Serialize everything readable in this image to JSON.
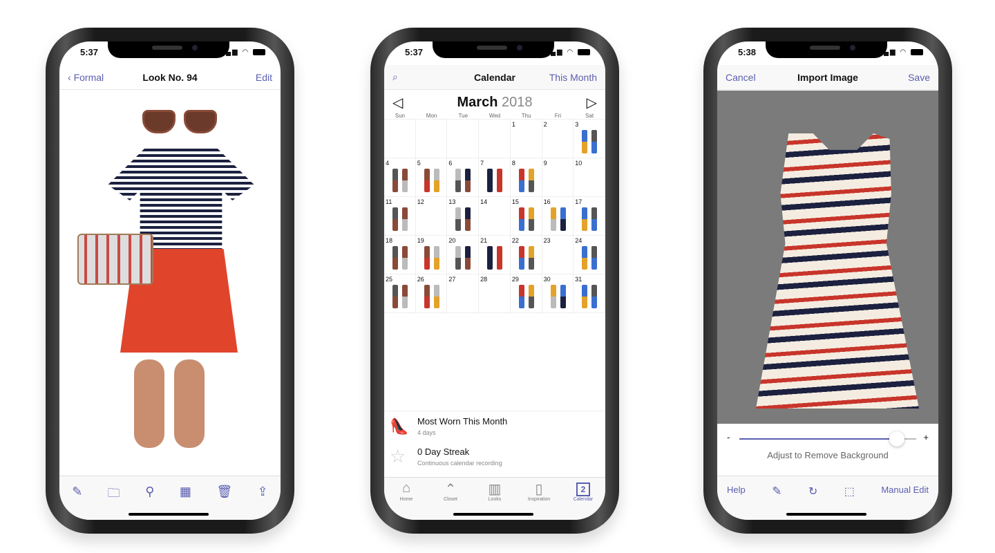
{
  "phone1": {
    "time": "5:37",
    "back": "Formal",
    "title": "Look No. 94",
    "edit": "Edit",
    "toolbar": [
      "compose-icon",
      "folder-icon",
      "outfit-icon",
      "calendar-icon",
      "trash-icon",
      "share-icon"
    ]
  },
  "phone2": {
    "time": "5:37",
    "title": "Calendar",
    "right": "This Month",
    "month": "March",
    "year": "2018",
    "weekdays": [
      "Sun",
      "Mon",
      "Tue",
      "Wed",
      "Thu",
      "Fri",
      "Sat"
    ],
    "first_weekday": 4,
    "days_in_month": 31,
    "days_with_outfits": [
      3,
      4,
      5,
      6,
      7,
      8,
      11,
      13,
      15,
      16,
      17,
      18,
      19,
      20,
      21,
      22,
      24,
      25,
      26,
      29,
      30,
      31
    ],
    "stats": [
      {
        "title": "Most Worn This Month",
        "sub": "4 days"
      },
      {
        "title": "0 Day Streak",
        "sub": "Continuous calendar recording"
      }
    ],
    "tabs": [
      {
        "label": "Home",
        "icon": "home-icon"
      },
      {
        "label": "Closet",
        "icon": "hanger-icon"
      },
      {
        "label": "Looks",
        "icon": "looks-icon"
      },
      {
        "label": "Inspiration",
        "icon": "inspiration-icon"
      },
      {
        "label": "Calendar",
        "icon": "calendar-icon",
        "active": true,
        "badge": "2"
      }
    ]
  },
  "phone3": {
    "time": "5:38",
    "cancel": "Cancel",
    "title": "Import Image",
    "save": "Save",
    "minus": "-",
    "plus": "+",
    "slider_value": 0.84,
    "hint": "Adjust to Remove Background",
    "help": "Help",
    "manual": "Manual Edit",
    "bg": "#7b7b7b"
  },
  "accent": "#5a5eaf"
}
